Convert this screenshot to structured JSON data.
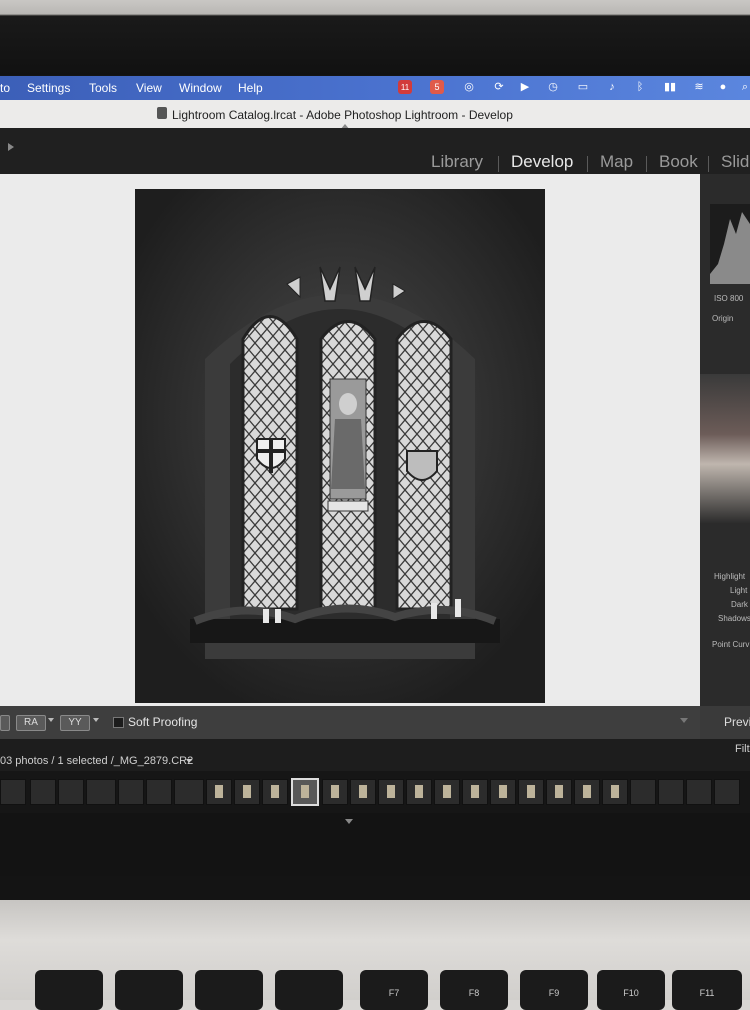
{
  "menubar": {
    "items": [
      "to",
      "Settings",
      "Tools",
      "View",
      "Window",
      "Help"
    ],
    "tray_badges": [
      "11",
      "5"
    ],
    "colors": {
      "bar": "#4b73d0"
    }
  },
  "window": {
    "title": "Lightroom Catalog.lrcat - Adobe Photoshop Lightroom - Develop"
  },
  "modules": [
    {
      "label": "Library",
      "active": false
    },
    {
      "label": "Develop",
      "active": true
    },
    {
      "label": "Map",
      "active": false
    },
    {
      "label": "Book",
      "active": false
    },
    {
      "label": "Slide",
      "active": false
    }
  ],
  "right_panel": {
    "iso": "ISO 800",
    "original": "Origin",
    "tone_labels": [
      "Highlight",
      "Light",
      "Dark",
      "Shadows"
    ],
    "point_curve": "Point Curv",
    "preview": "Previ"
  },
  "toolbar": {
    "soft_proofing": "Soft Proofing",
    "view_buttons": [
      "RA",
      "YY"
    ]
  },
  "filmstrip": {
    "info": "03 photos / 1 selected /_MG_2879.CR2",
    "filter_label": "Filte",
    "selected_index": 10
  },
  "keyboard": {
    "keys": [
      "F7",
      "F8",
      "F9",
      "F10",
      "F11"
    ]
  }
}
